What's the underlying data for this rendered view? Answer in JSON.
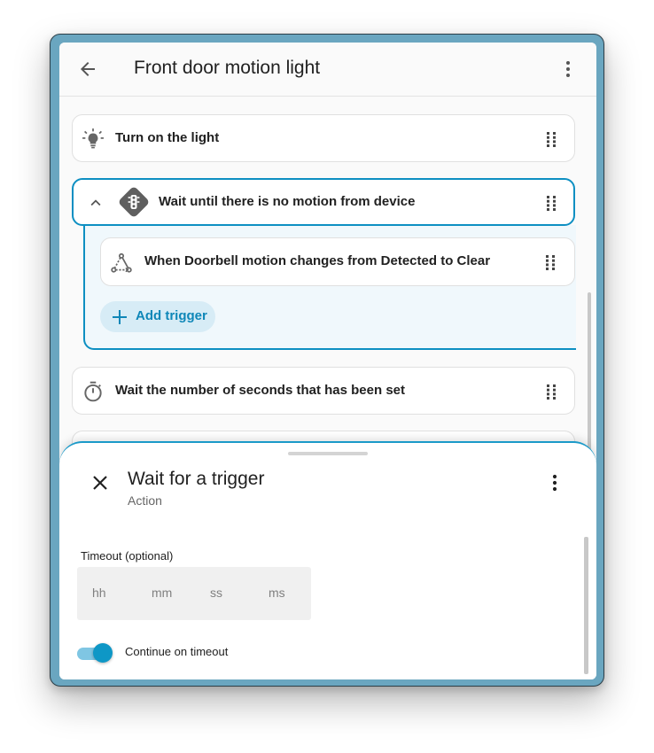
{
  "header": {
    "title": "Front door motion light",
    "back_icon": "arrow-left-icon",
    "menu_icon": "dots-vertical-icon"
  },
  "actions": [
    {
      "label": "Turn on the light",
      "icon": "lightbulb-icon"
    },
    {
      "label": "Wait until there is no motion from device",
      "icon": "traffic-light-icon",
      "expanded": true
    },
    {
      "label": "Wait the number of seconds that has been set",
      "icon": "timer-icon"
    }
  ],
  "triggers": [
    {
      "label": "When Doorbell motion changes from Detected to Clear",
      "icon": "device-hub-icon"
    }
  ],
  "add_trigger_label": "Add trigger",
  "sheet": {
    "title": "Wait for a trigger",
    "subtitle": "Action",
    "timeout_label": "Timeout (optional)",
    "fields": {
      "hh": "hh",
      "mm": "mm",
      "ss": "ss",
      "ms": "ms"
    },
    "continue_label": "Continue on timeout",
    "continue_on": true
  },
  "colors": {
    "accent": "#0d8fc2",
    "device_frame": "#6aa6c0",
    "toggle_thumb": "#0e97c6"
  }
}
